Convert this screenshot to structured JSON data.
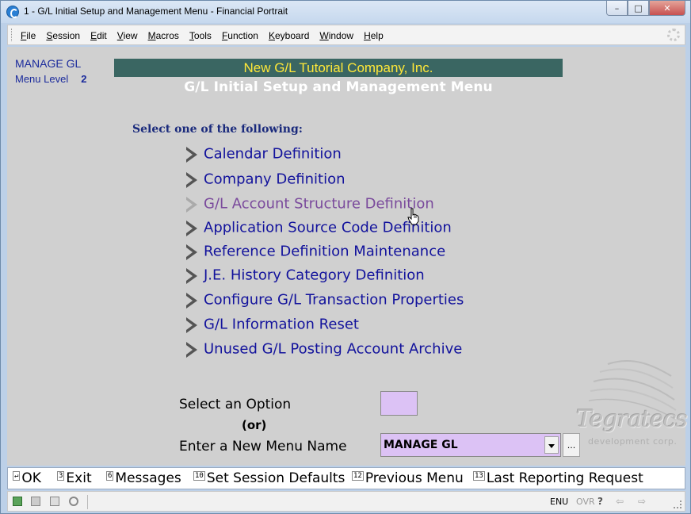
{
  "window": {
    "title": "1 - G/L Initial Setup and Management Menu - Financial Portrait",
    "buttons": {
      "minimize": "–",
      "maximize": "□",
      "close": "✕"
    }
  },
  "menubar": {
    "items": [
      {
        "accel": "F",
        "rest": "ile"
      },
      {
        "accel": "S",
        "rest": "ession"
      },
      {
        "accel": "E",
        "rest": "dit"
      },
      {
        "accel": "V",
        "rest": "iew"
      },
      {
        "accel": "M",
        "rest": "acros"
      },
      {
        "accel": "T",
        "rest": "ools"
      },
      {
        "accel": "F",
        "rest": "unction"
      },
      {
        "accel": "K",
        "rest": "eyboard"
      },
      {
        "accel": "W",
        "rest": "indow"
      },
      {
        "accel": "H",
        "rest": "elp"
      }
    ]
  },
  "header": {
    "menu_name": "MANAGE GL",
    "menu_level_label": "Menu Level",
    "menu_level_value": "2",
    "company": "New G/L Tutorial Company, Inc.",
    "title": "G/L Initial Setup and Management Menu"
  },
  "main": {
    "prompt": "Select one of the following:",
    "options": [
      {
        "label": "Calendar Definition",
        "hovered": false
      },
      {
        "label": "Company Definition",
        "hovered": false
      },
      {
        "label": "G/L Account Structure Definition",
        "hovered": true
      },
      {
        "label": "Application Source Code Definition",
        "hovered": false
      },
      {
        "label": "Reference Definition Maintenance",
        "hovered": false
      },
      {
        "label": "J.E. History Category Definition",
        "hovered": false
      },
      {
        "label": "Configure G/L Transaction Properties",
        "hovered": false
      },
      {
        "label": "G/L Information Reset",
        "hovered": false
      },
      {
        "label": "Unused G/L Posting Account Archive",
        "hovered": false
      }
    ],
    "select_option_label": "Select an Option",
    "select_option_value": "",
    "or_label": "(or)",
    "new_menu_label": "Enter a New Menu Name",
    "new_menu_value": "MANAGE GL",
    "browse_label": "..."
  },
  "logo": {
    "name": "Tegratecs",
    "tagline": "development corp."
  },
  "fkeys": [
    {
      "key": "↵",
      "label": "OK"
    },
    {
      "key": "3",
      "label": "Exit"
    },
    {
      "key": "6",
      "label": "Messages"
    },
    {
      "key": "10",
      "label": "Set Session Defaults"
    },
    {
      "key": "12",
      "label": "Previous Menu"
    },
    {
      "key": "13",
      "label": "Last Reporting Request"
    }
  ],
  "statusbar": {
    "language": "ENU",
    "mode": "OVR",
    "help": "?",
    "back": "⇦",
    "forward": "⇨"
  },
  "colors": {
    "company_bar": "#3a6662",
    "company_text": "#ffe838",
    "option_text": "#12129c",
    "option_hover": "#7a4a9c",
    "input_bg": "#dcc2f5",
    "content_bg": "#d0d0d0"
  }
}
